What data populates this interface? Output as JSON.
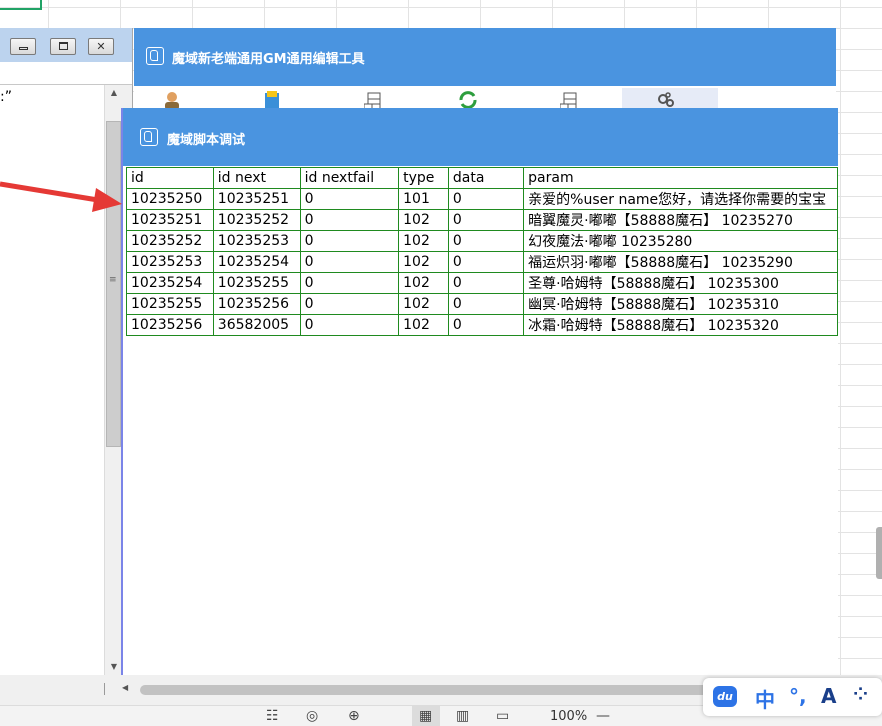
{
  "colors": {
    "title_blue": "#4a94e0",
    "grid_green": "#1f8a1f",
    "arrow_red": "#e53935",
    "ime_blue": "#2d73e6"
  },
  "left_window": {
    "text_fragment": ":”"
  },
  "gm_window": {
    "title": "魔域新老端通用GM通用编辑工具",
    "toolbar_icons": [
      "user-icon",
      "book-icon",
      "database-icon",
      "refresh-icon",
      "database-icon",
      "gear-cluster-icon"
    ]
  },
  "debug_window": {
    "title": "魔域脚本调试",
    "columns": [
      "id",
      "id next",
      "id nextfail",
      "type",
      "data",
      "param"
    ],
    "rows": [
      [
        "10235250",
        "10235251",
        "0",
        "101",
        "0",
        "亲爱的%user name您好，请选择你需要的宝宝"
      ],
      [
        "10235251",
        "10235252",
        "0",
        "102",
        "0",
        "暗翼魔灵·嘟嘟【58888魔石】 10235270"
      ],
      [
        "10235252",
        "10235253",
        "0",
        "102",
        "0",
        "幻夜魔法·嘟嘟 10235280"
      ],
      [
        "10235253",
        "10235254",
        "0",
        "102",
        "0",
        "福运炽羽·嘟嘟【58888魔石】 10235290"
      ],
      [
        "10235254",
        "10235255",
        "0",
        "102",
        "0",
        "圣尊·哈姆特【58888魔石】 10235300"
      ],
      [
        "10235255",
        "10235256",
        "0",
        "102",
        "0",
        "幽冥·哈姆特【58888魔石】 10235310"
      ],
      [
        "10235256",
        "36582005",
        "0",
        "102",
        "0",
        "冰霜·哈姆特【58888魔石】 10235320"
      ]
    ]
  },
  "status_bar": {
    "zoom": "100%",
    "zoom_caret": "⌄"
  },
  "ime": {
    "logo": "du",
    "lang": "中",
    "punct": "°,",
    "skin": "A",
    "grid": "⁘"
  }
}
